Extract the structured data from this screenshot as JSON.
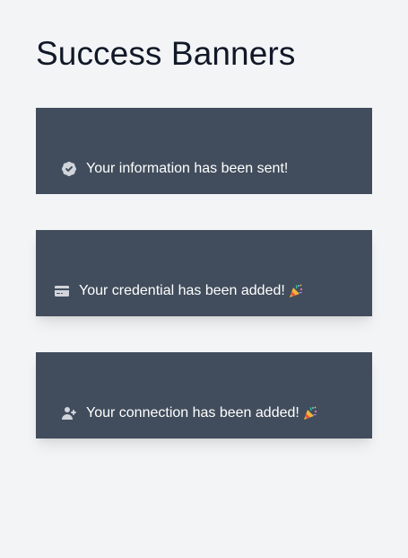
{
  "page": {
    "title": "Success Banners"
  },
  "banners": [
    {
      "text": "Your information has been sent!",
      "icon": "badge-check-icon",
      "emoji": ""
    },
    {
      "text": "Your credential has been added!",
      "icon": "credit-card-icon",
      "emoji": "party-popper"
    },
    {
      "text": "Your connection has been added!",
      "icon": "user-add-icon",
      "emoji": "party-popper"
    }
  ],
  "colors": {
    "background": "#f3f4f6",
    "banner": "#414d5c",
    "banner_text": "#ffffff",
    "icon": "#d1d5db"
  }
}
